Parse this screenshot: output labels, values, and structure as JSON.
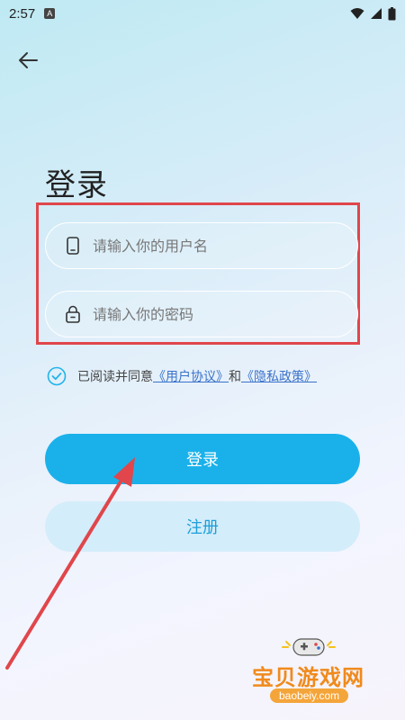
{
  "status_bar": {
    "time": "2:57",
    "notif_letter": "A"
  },
  "page": {
    "title": "登录"
  },
  "form": {
    "username_placeholder": "请输入你的用户名",
    "password_placeholder": "请输入你的密码"
  },
  "agreement": {
    "prefix": "已阅读并同意",
    "user_agreement": "《用户协议》",
    "and": "和",
    "privacy_policy": "《隐私政策》",
    "checked": true
  },
  "buttons": {
    "login": "登录",
    "register": "注册"
  },
  "watermark": {
    "text": "宝贝游戏网",
    "url": "baobeiy.com"
  },
  "colors": {
    "accent": "#1ab1ea",
    "secondary_bg": "#d4edfa",
    "link": "#3a72c9",
    "annotation": "#e0464b"
  }
}
